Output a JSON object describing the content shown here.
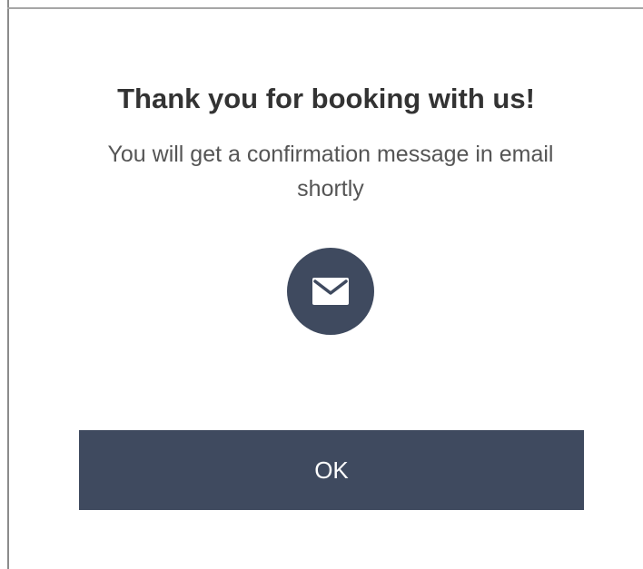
{
  "dialog": {
    "title": "Thank you for booking with us!",
    "message": "You will get a confirmation message in email shortly",
    "icon": "envelope-icon",
    "ok_label": "OK"
  },
  "colors": {
    "accent": "#3f4a5f",
    "title_text": "#333333",
    "body_text": "#555555",
    "background": "#ffffff"
  }
}
